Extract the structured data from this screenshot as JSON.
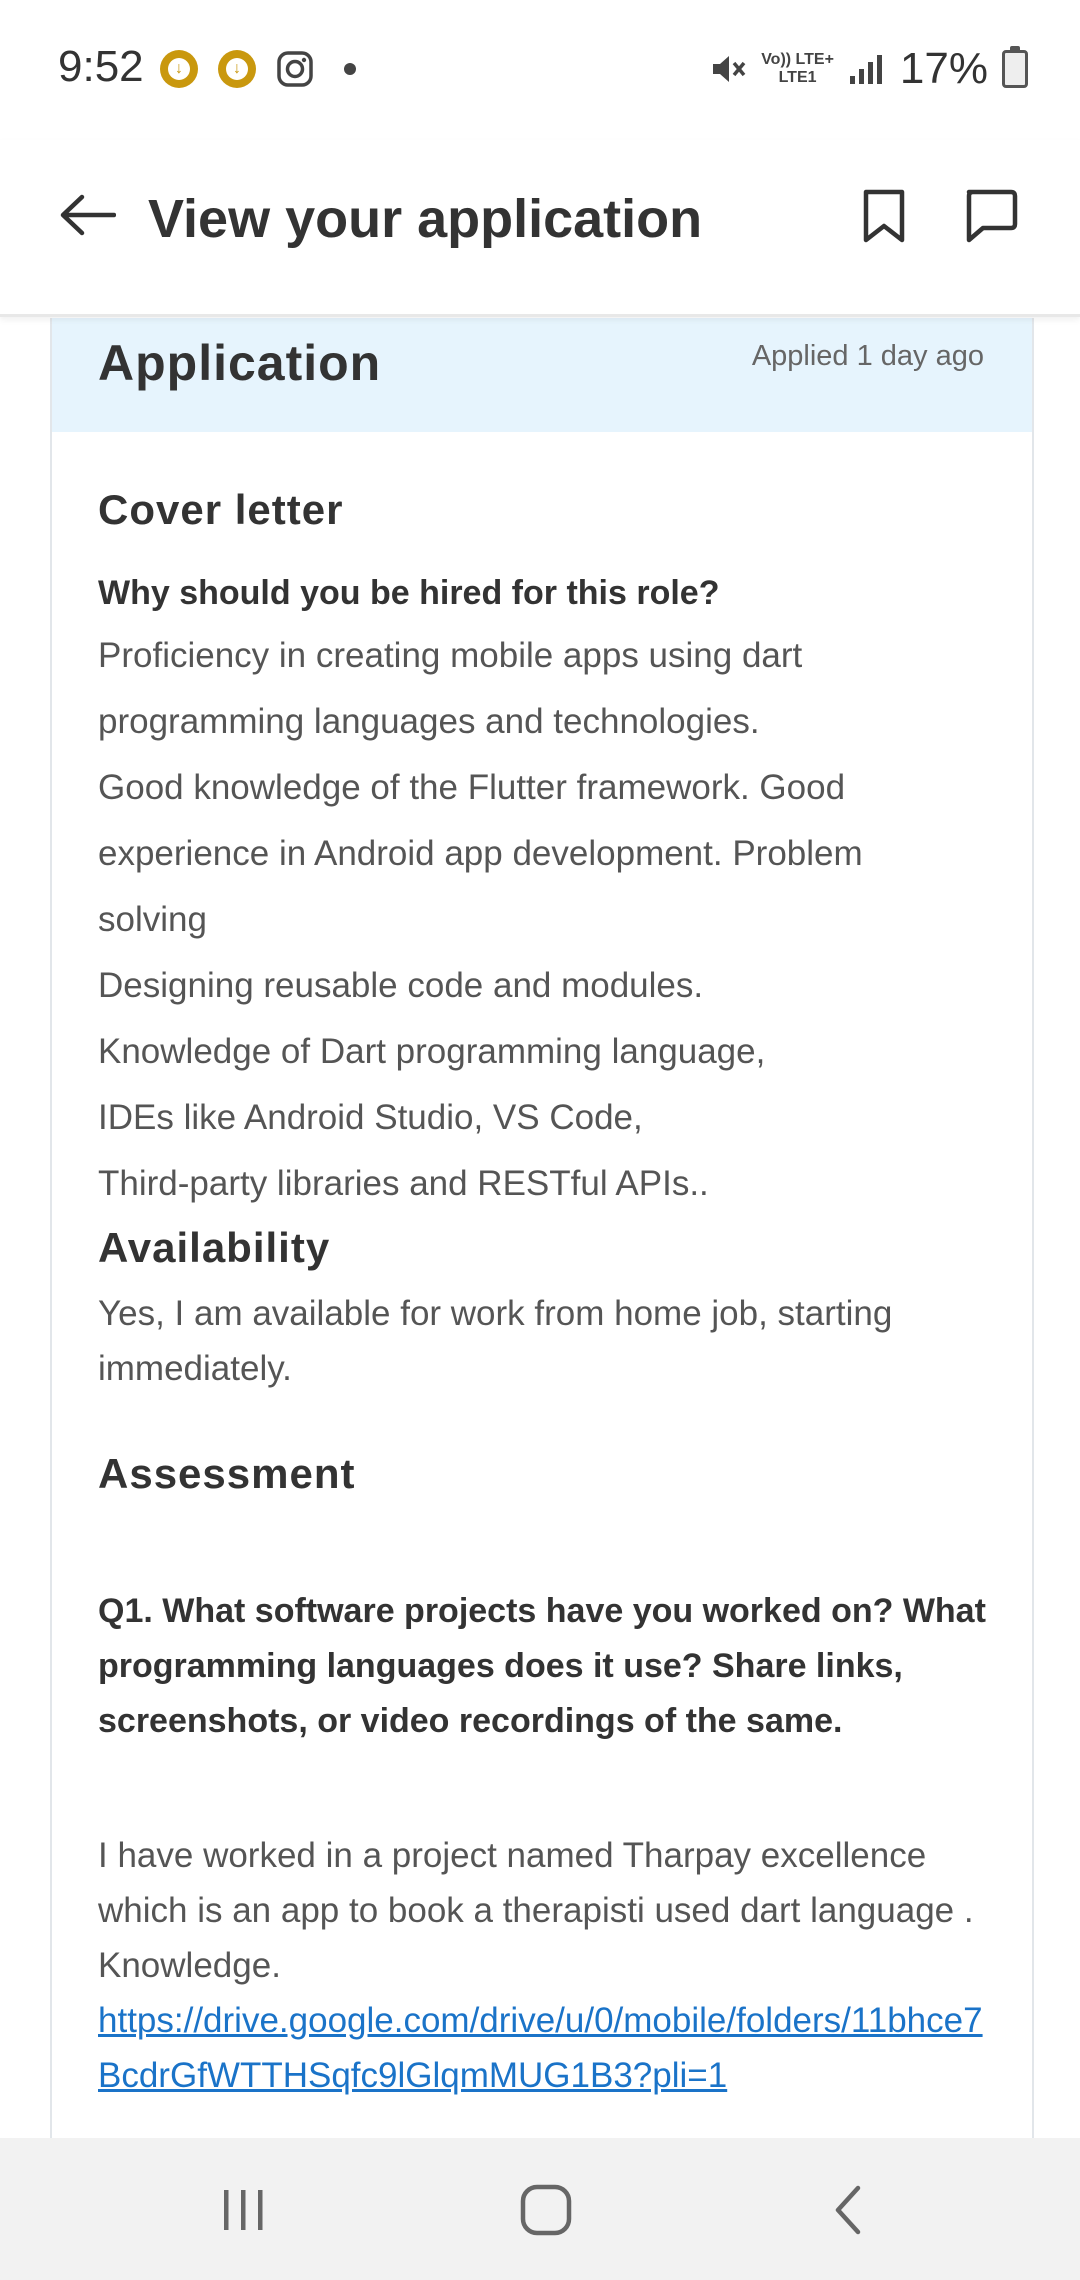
{
  "status_bar": {
    "time": "9:52",
    "network_top": "Vo)) LTE+",
    "network_bottom": "LTE1",
    "battery": "17%"
  },
  "header": {
    "title": "View your application"
  },
  "application": {
    "title": "Application",
    "applied": "Applied 1 day ago",
    "cover_letter": {
      "title": "Cover letter",
      "question": "Why should you be hired for this role?",
      "lines": [
        "Proficiency in creating mobile apps using dart",
        "programming languages and technologies.",
        "Good knowledge of the Flutter framework. Good",
        "experience in  Android app development. Problem",
        "solving",
        "Designing reusable code and modules.",
        "Knowledge of Dart programming language,",
        "IDEs like Android Studio, VS Code,",
        "Third-party libraries and RESTful APIs.."
      ]
    },
    "availability": {
      "title": "Availability",
      "text": "Yes, I am available for work from home job, starting immediately."
    },
    "assessment": {
      "title": "Assessment",
      "q1": "Q1. What software projects have you worked on? What programming languages does it use? Share links, screenshots, or video recordings of the same.",
      "a1": "I have worked in a project named Tharpay excellence which is an app to book a therapisti used dart language .",
      "a1_line2": "Knowledge.",
      "a1_link": "https://drive.google.com/drive/u/0/mobile/folders/11bhce7BcdrGfWTTHSqfc9lGlqmMUG1B3?pli=1"
    }
  },
  "colors": {
    "header_band": "#e6f4fd",
    "link": "#1a73c8",
    "coin": "#c9980e"
  },
  "icons": [
    "download-coin-icon",
    "instagram-icon",
    "mute-icon",
    "signal-icon",
    "battery-icon",
    "back-arrow-icon",
    "bookmark-icon",
    "chat-icon",
    "recents-icon",
    "home-icon",
    "nav-back-icon"
  ]
}
